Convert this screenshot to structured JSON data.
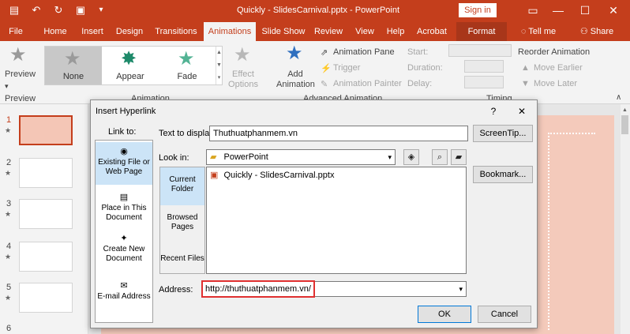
{
  "app": {
    "window_title": "Quickly - SlidesCarnival.pptx  -  PowerPoint",
    "sign_in": "Sign in",
    "tell_me": "Tell me",
    "share": "Share"
  },
  "tabs": [
    "File",
    "Home",
    "Insert",
    "Design",
    "Transitions",
    "Animations",
    "Slide Show",
    "Review",
    "View",
    "Help",
    "Acrobat",
    "Format"
  ],
  "active_tab": "Animations",
  "ribbon": {
    "preview_label": "Preview",
    "preview_group": "Preview",
    "gallery": [
      "None",
      "Appear",
      "Fade"
    ],
    "effect_options": "Effect\nOptions",
    "animation_group": "Animation",
    "add_animation": "Add\nAnimation",
    "animation_pane": "Animation Pane",
    "trigger": "Trigger",
    "animation_painter": "Animation Painter",
    "advanced_group": "Advanced Animation",
    "start": "Start:",
    "duration": "Duration:",
    "delay": "Delay:",
    "timing_group": "Timing",
    "reorder": "Reorder Animation",
    "move_earlier": "Move Earlier",
    "move_later": "Move Later"
  },
  "slides": [
    "1",
    "2",
    "3",
    "4",
    "5",
    "6"
  ],
  "dialog": {
    "title": "Insert Hyperlink",
    "help": "?",
    "close": "✕",
    "link_to": "Link to:",
    "link_items": [
      "Existing File or\nWeb Page",
      "Place in This\nDocument",
      "Create New\nDocument",
      "E-mail Address"
    ],
    "text_to_display_label": "Text to display:",
    "text_to_display_value": "Thuthuatphanmem.vn",
    "screentip": "ScreenTip...",
    "look_in_label": "Look in:",
    "look_in_value": "PowerPoint",
    "nav_items": [
      "Current\nFolder",
      "Browsed\nPages",
      "Recent Files"
    ],
    "files": [
      "Quickly - SlidesCarnival.pptx"
    ],
    "bookmark": "Bookmark...",
    "address_label": "Address:",
    "address_value": "http://thuthuatphanmem.vn/",
    "ok": "OK",
    "cancel": "Cancel"
  },
  "colors": {
    "brand": "#c43e1c",
    "selection": "#cce4f7",
    "highlight_red": "#e03030"
  }
}
